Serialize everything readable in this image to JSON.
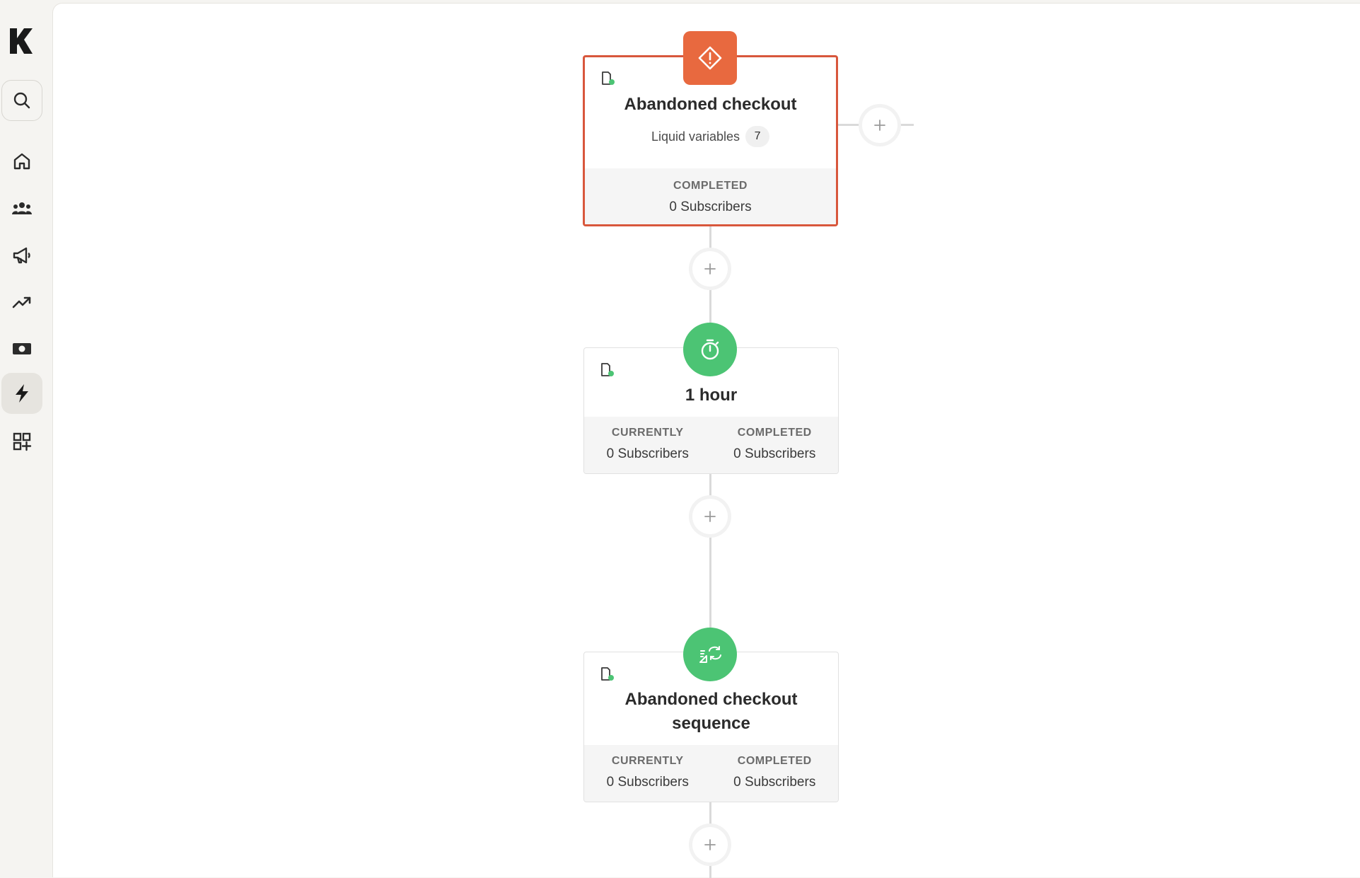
{
  "sidebar": {
    "logo": "K",
    "items": [
      {
        "name": "search",
        "icon": "search-icon"
      },
      {
        "name": "home",
        "icon": "home-icon"
      },
      {
        "name": "audience",
        "icon": "users-icon"
      },
      {
        "name": "campaigns",
        "icon": "megaphone-icon"
      },
      {
        "name": "analytics",
        "icon": "trend-up-icon"
      },
      {
        "name": "revenue",
        "icon": "money-icon"
      },
      {
        "name": "flows",
        "icon": "lightning-icon",
        "active": true
      },
      {
        "name": "integrations",
        "icon": "apps-add-icon"
      }
    ]
  },
  "flow": {
    "trigger": {
      "title": "Abandoned checkout",
      "liquid_label": "Liquid variables",
      "liquid_count": "7",
      "completed_label": "COMPLETED",
      "completed_value": "0 Subscribers"
    },
    "delay": {
      "title": "1 hour",
      "currently_label": "CURRENTLY",
      "currently_value": "0 Subscribers",
      "completed_label": "COMPLETED",
      "completed_value": "0 Subscribers"
    },
    "sequence": {
      "title_line1": "Abandoned checkout",
      "title_line2": "sequence",
      "currently_label": "CURRENTLY",
      "currently_value": "0 Subscribers",
      "completed_label": "COMPLETED",
      "completed_value": "0 Subscribers"
    }
  },
  "colors": {
    "trigger_accent": "#e8693f",
    "selected_border": "#d8573c",
    "action_green": "#4cc474",
    "status_dot": "#4cc474"
  }
}
